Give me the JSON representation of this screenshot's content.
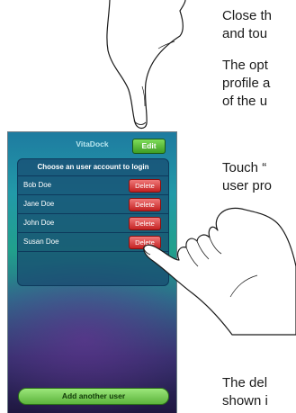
{
  "instructions": {
    "step1_line1": "Close th",
    "step1_line2": "and tou",
    "step2_line1": "The opt",
    "step2_line2": "profile a",
    "step2_line3": "of the u",
    "step3_line1": "Touch “",
    "step3_line2": "user pro",
    "step4_line1": "The del",
    "step4_line2": "shown i"
  },
  "app": {
    "title": "VitaDock",
    "edit_label": "Edit",
    "panel_header": "Choose an user account to login",
    "users": [
      {
        "name": "Bob Doe",
        "delete_label": "Delete"
      },
      {
        "name": "Jane Doe",
        "delete_label": "Delete"
      },
      {
        "name": "John Doe",
        "delete_label": "Delete"
      },
      {
        "name": "Susan Doe",
        "delete_label": "Delete"
      }
    ],
    "add_user_label": "Add another user"
  },
  "colors": {
    "edit_button": "#4caf2e",
    "delete_button": "#d93030",
    "add_button": "#6cc04a"
  }
}
